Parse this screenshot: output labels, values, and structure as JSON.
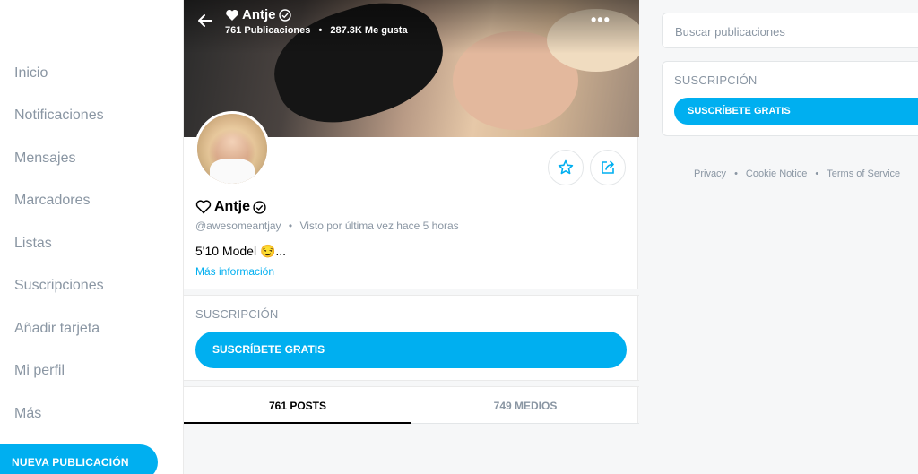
{
  "sidebar": {
    "items": [
      {
        "label": "Inicio"
      },
      {
        "label": "Notificaciones"
      },
      {
        "label": "Mensajes"
      },
      {
        "label": "Marcadores"
      },
      {
        "label": "Listas"
      },
      {
        "label": "Suscripciones"
      },
      {
        "label": "Añadir tarjeta"
      },
      {
        "label": "Mi perfil"
      },
      {
        "label": "Más"
      }
    ],
    "new_post_label": "NUEVA PUBLICACIÓN"
  },
  "header": {
    "name": "Antje",
    "posts_count": "761 Publicaciones",
    "likes_count": "287.3K Me gusta",
    "heart_icon": "heart-icon",
    "verified_icon": "verified-check-icon",
    "menu_icon": "more-dots-icon"
  },
  "profile": {
    "name": "Antje",
    "handle": "@awesomeantjay",
    "separator": "•",
    "last_seen": "Visto por última vez hace 5 horas",
    "bio": "5'10 Model 😏...",
    "more_info": "Más información"
  },
  "subscription": {
    "title": "SUSCRIPCIÓN",
    "button_label": "SUSCRÍBETE GRATIS"
  },
  "tabs": [
    {
      "label": "761 POSTS"
    },
    {
      "label": "749 MEDIOS"
    }
  ],
  "right": {
    "search_placeholder": "Buscar publicaciones",
    "subscription_title": "SUSCRIPCIÓN",
    "subscription_button": "SUSCRÍBETE GRATIS",
    "footer": {
      "privacy": "Privacy",
      "cookie": "Cookie Notice",
      "terms": "Terms of Service",
      "separator": "•"
    }
  },
  "colors": {
    "accent": "#00aff0",
    "muted_text": "#8a96a3"
  }
}
